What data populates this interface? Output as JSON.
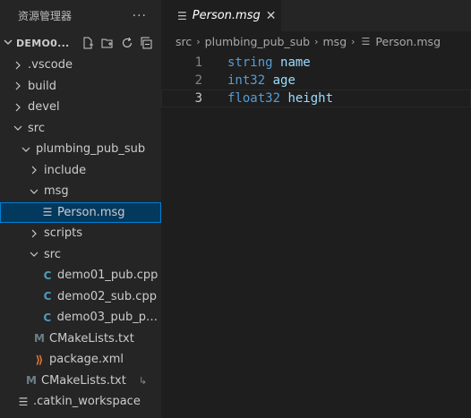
{
  "explorer": {
    "title": "资源管理器",
    "more": "···",
    "workspace": "DEMO0...",
    "items": [
      {
        "label": ".vscode",
        "kind": "folder",
        "open": false,
        "indent": 1
      },
      {
        "label": "build",
        "kind": "folder",
        "open": false,
        "indent": 1
      },
      {
        "label": "devel",
        "kind": "folder",
        "open": false,
        "indent": 1
      },
      {
        "label": "src",
        "kind": "folder",
        "open": true,
        "indent": 1
      },
      {
        "label": "plumbing_pub_sub",
        "kind": "folder",
        "open": true,
        "indent": 2
      },
      {
        "label": "include",
        "kind": "folder",
        "open": false,
        "indent": 3
      },
      {
        "label": "msg",
        "kind": "folder",
        "open": true,
        "indent": 3
      },
      {
        "label": "Person.msg",
        "kind": "text",
        "indent": 4,
        "selected": true
      },
      {
        "label": "scripts",
        "kind": "folder",
        "open": false,
        "indent": 3
      },
      {
        "label": "src",
        "kind": "folder",
        "open": true,
        "indent": 3
      },
      {
        "label": "demo01_pub.cpp",
        "kind": "cpp",
        "indent": 4
      },
      {
        "label": "demo02_sub.cpp",
        "kind": "cpp",
        "indent": 4
      },
      {
        "label": "demo03_pub_pe...",
        "kind": "cpp",
        "indent": 4
      },
      {
        "label": "CMakeLists.txt",
        "kind": "cmake",
        "indent": 3
      },
      {
        "label": "package.xml",
        "kind": "xml",
        "indent": 3
      },
      {
        "label": "CMakeLists.txt",
        "kind": "cmake",
        "indent": 2,
        "badge": "↳"
      },
      {
        "label": ".catkin_workspace",
        "kind": "text",
        "indent": 1
      }
    ]
  },
  "editor": {
    "tab": {
      "label": "Person.msg",
      "close": "✕"
    },
    "breadcrumb": [
      "src",
      "plumbing_pub_sub",
      "msg",
      "Person.msg"
    ],
    "lines": [
      {
        "num": "1",
        "type": "string",
        "name": "name"
      },
      {
        "num": "2",
        "type": "int32",
        "name": "age"
      },
      {
        "num": "3",
        "type": "float32",
        "name": "height"
      }
    ],
    "current_line": "3"
  },
  "colors": {
    "selection_bg": "#04395e",
    "selection_border": "#007fd4",
    "cpp_icon": "#519aba",
    "cmake_icon": "#6d8086",
    "xml_icon": "#e37933",
    "keyword": "#569cd6",
    "identifier": "#9cdcfe"
  }
}
